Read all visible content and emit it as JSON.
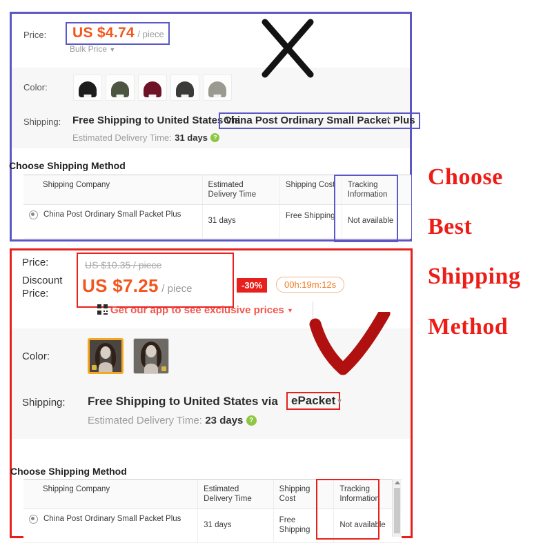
{
  "panel_top": {
    "price_label": "Price:",
    "price_value": "US $4.74",
    "price_unit": "/ piece",
    "bulk_price": "Bulk Price",
    "color_label": "Color:",
    "color_swatches": [
      {
        "name": "black",
        "hex": "#1d1d1d"
      },
      {
        "name": "army-green",
        "hex": "#4d5540"
      },
      {
        "name": "wine-red",
        "hex": "#6e1326"
      },
      {
        "name": "dark-grey",
        "hex": "#3b3b39"
      },
      {
        "name": "light-grey",
        "hex": "#9a9a90"
      }
    ],
    "shipping_label": "Shipping:",
    "shipping_text": "Free Shipping to United States via",
    "shipping_method": "China Post Ordinary Small Packet Plus",
    "delivery_prefix": "Estimated Delivery Time:",
    "delivery_value": "31 days",
    "help_icon": "?",
    "choose_shipping_method": "Choose Shipping Method",
    "table": {
      "headers": [
        "Shipping Company",
        "Estimated Delivery Time",
        "Shipping Cost",
        "Tracking Information"
      ],
      "rows": [
        {
          "selected": true,
          "company": "China Post Ordinary Small Packet Plus",
          "time": "31 days",
          "cost": "Free Shipping",
          "tracking": "Not available"
        }
      ]
    }
  },
  "panel_bottom": {
    "price_label": "Price:",
    "original_price": "US $10.35 / piece",
    "discount_label_line1": "Discount",
    "discount_label_line2": "Price:",
    "discount_value": "US $7.25",
    "discount_unit": "/ piece",
    "discount_badge": "-30%",
    "countdown": "00h:19m:12s",
    "app_promo": "Get our app to see exclusive prices",
    "color_label": "Color:",
    "color_thumbs": [
      {
        "name": "wig-dark-selected",
        "selected": true
      },
      {
        "name": "wig-dark-2",
        "selected": false
      }
    ],
    "shipping_label": "Shipping:",
    "shipping_text": "Free Shipping to United States via",
    "shipping_method": "ePacket",
    "delivery_prefix": "Estimated Delivery Time:",
    "delivery_value": "23 days",
    "help_icon": "?",
    "choose_shipping_method": "Choose Shipping Method",
    "table": {
      "headers": [
        "Shipping Company",
        "Estimated Delivery Time",
        "Shipping Cost",
        "Tracking Information"
      ],
      "rows": [
        {
          "selected": true,
          "company": "China Post Ordinary Small Packet Plus",
          "time": "31 days",
          "cost": "Free Shipping",
          "tracking": "Not available"
        }
      ]
    }
  },
  "annotations": {
    "line1": "Choose",
    "line2": "Best",
    "line3": "Shipping",
    "line4": "Method",
    "cross_mark": "x-mark-annotation",
    "check_mark": "check-mark-annotation",
    "color": "#ee1c16"
  },
  "colors": {
    "accent_orange": "#f4551d",
    "highlight_blue": "#5b57c4",
    "highlight_red": "#e8201c",
    "annotation_red": "#ee1c16",
    "selected_thumb_border": "#f5a623"
  }
}
